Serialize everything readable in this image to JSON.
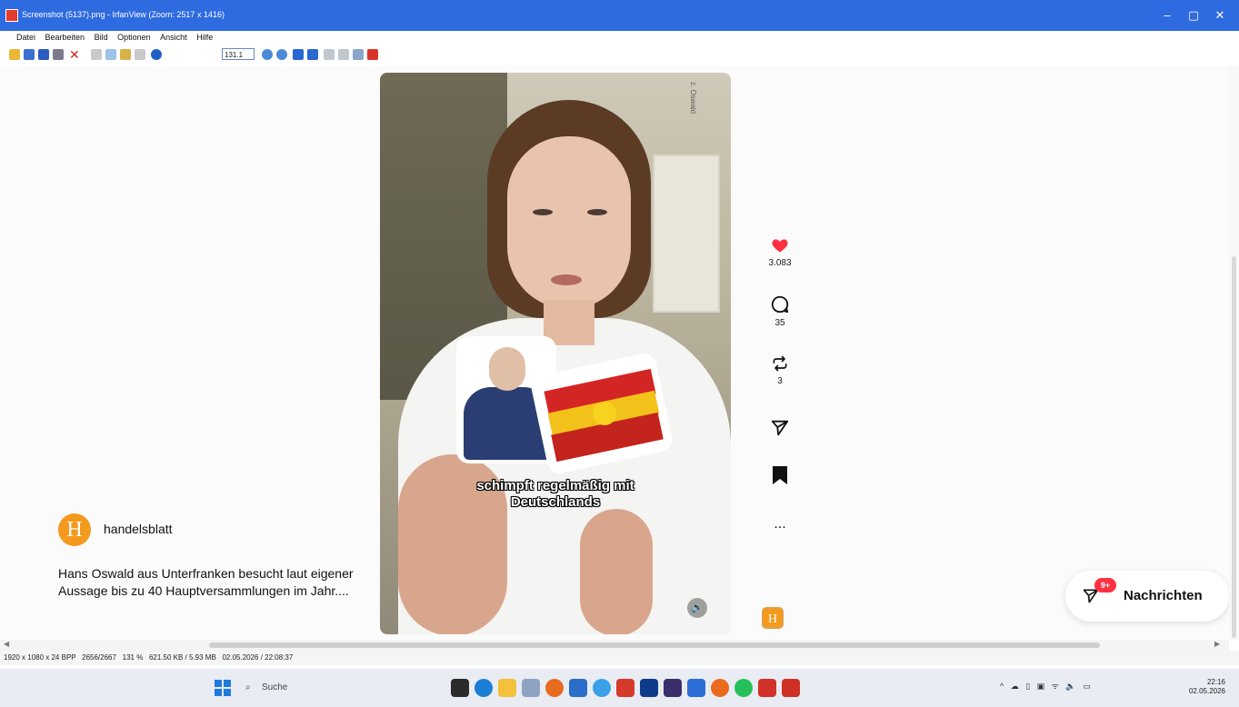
{
  "window": {
    "title": "Screenshot (5137).png - IrfanView (Zoom: 2517 x 1416)"
  },
  "menu": [
    "Datei",
    "Bearbeiten",
    "Bild",
    "Optionen",
    "Ansicht",
    "Hilfe"
  ],
  "toolbar": {
    "zoom_value": "131.1"
  },
  "post": {
    "author": "handelsblatt",
    "avatar_letter": "H",
    "description": "Hans Oswald aus Unterfranken besucht laut eigener Aussage bis zu 40 Hauptversammlungen im Jahr....",
    "caption_line1": "schimpft regelmäßig mit",
    "caption_line2": "Deutschlands",
    "watermark": "z. Oswald"
  },
  "actions": {
    "likes": "3.083",
    "comments": "35",
    "reposts": "3",
    "more": "..."
  },
  "messages": {
    "label": "Nachrichten",
    "badge": "9+"
  },
  "status": {
    "text": "1920 x 1080 x 24 BPP   2656/2667   131 %   621.50 KB / 5.93 MB   02.05.2026 / 22:08:37"
  },
  "taskbar": {
    "search_label": "Suche",
    "time": "22:16",
    "date": "02.05.2026"
  },
  "colors": {
    "titlebar": "#2f6be0",
    "like": "#ff3040",
    "brand": "#f39a1e"
  }
}
